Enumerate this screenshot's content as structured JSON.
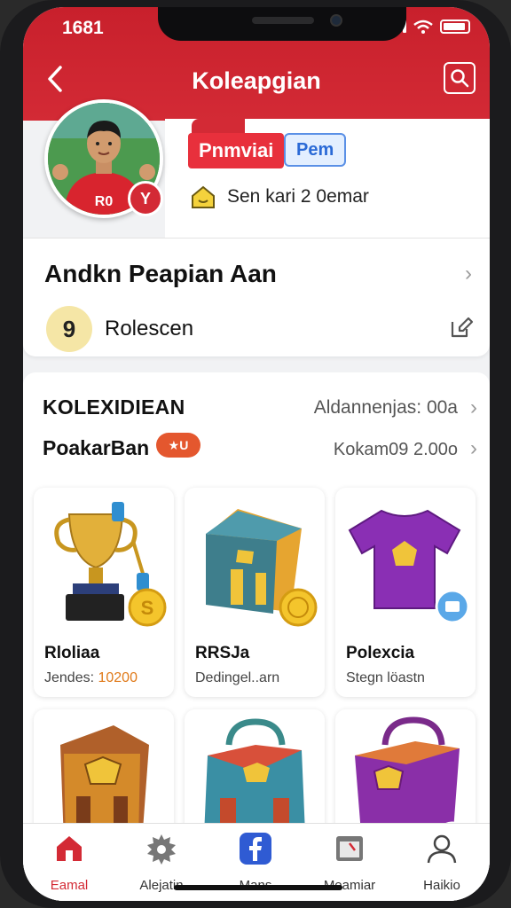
{
  "status": {
    "time": "1681"
  },
  "header": {
    "title": "Koleapgian",
    "back_icon": "back-chevron-icon",
    "search_icon": "search-icon"
  },
  "profile": {
    "badge_primary": "Pnmviai",
    "badge_secondary": "Pem",
    "member_text": "Sen kari 2 0emar",
    "avatar_badge_text": "Y",
    "jersey_text": "R0"
  },
  "info": {
    "user_name": "Andkn Peapian Aan",
    "role_icon_text": "9",
    "role_label": "Rolescen"
  },
  "collection": {
    "title": "KOLEXIDIEAN",
    "title_right": "Aldannenjas: 00a",
    "subtitle": "PoakarBan",
    "subtitle_badge": "★U",
    "subtitle_right": "Kokam09 2.00o"
  },
  "items": [
    {
      "name": "Rloliaa",
      "sub_prefix": "Jendes: ",
      "sub_highlight": "10200",
      "sub": "",
      "icon": "trophy-icon"
    },
    {
      "name": "RRSJa",
      "sub_prefix": "",
      "sub_highlight": "",
      "sub": "Dedingel..arn",
      "icon": "backpack-icon"
    },
    {
      "name": "Polexcia",
      "sub_prefix": "",
      "sub_highlight": "",
      "sub": "Stegn löastn",
      "icon": "tshirt-icon"
    },
    {
      "name": "",
      "sub_prefix": "",
      "sub_highlight": "",
      "sub": "",
      "icon": "backpack-icon"
    },
    {
      "name": "",
      "sub_prefix": "",
      "sub_highlight": "",
      "sub": "",
      "icon": "bag-icon"
    },
    {
      "name": "",
      "sub_prefix": "",
      "sub_highlight": "",
      "sub": "",
      "icon": "bag-icon"
    }
  ],
  "tabs": [
    {
      "label": "Eamal",
      "icon": "home-icon",
      "active": true
    },
    {
      "label": "Alejatin",
      "icon": "gear-icon",
      "active": false
    },
    {
      "label": "Mans",
      "icon": "facebook-icon",
      "active": false
    },
    {
      "label": "Meamiar",
      "icon": "calendar-icon",
      "active": false
    },
    {
      "label": "Haikio",
      "icon": "profile-icon",
      "active": false
    }
  ],
  "colors": {
    "brand_red": "#d32a35",
    "accent_blue": "#2a6ad6",
    "accent_orange": "#e4572e"
  }
}
